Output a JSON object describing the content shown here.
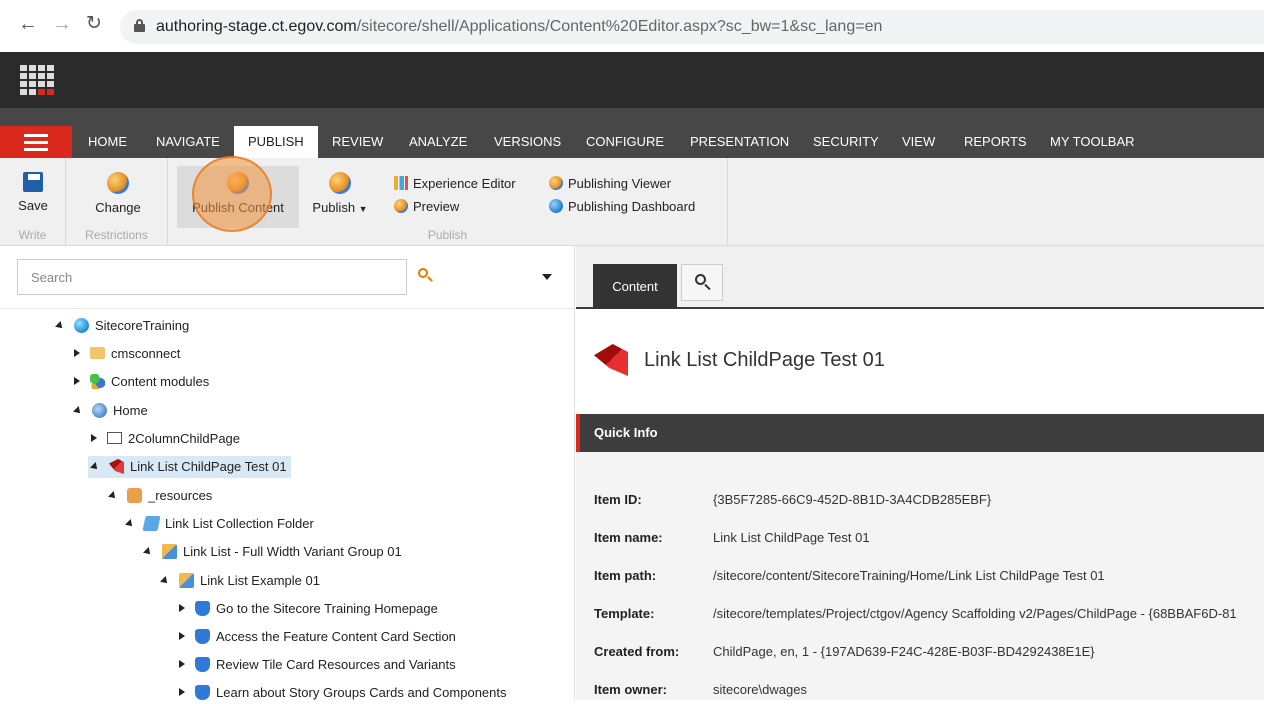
{
  "browser": {
    "back_icon": "back-arrow-icon",
    "forward_icon": "forward-arrow-icon",
    "reload_icon": "reload-icon",
    "url_host": "authoring-stage.ct.egov.com",
    "url_path": "/sitecore/shell/Applications/Content%20Editor.aspx?sc_bw=1&sc_lang=en"
  },
  "ribbon_tabs": [
    "HOME",
    "NAVIGATE",
    "PUBLISH",
    "REVIEW",
    "ANALYZE",
    "VERSIONS",
    "CONFIGURE",
    "PRESENTATION",
    "SECURITY",
    "VIEW",
    "REPORTS",
    "MY TOOLBAR"
  ],
  "active_tab": "PUBLISH",
  "ribbon": {
    "save": "Save",
    "write_group": "Write",
    "change": "Change",
    "restrictions_group": "Restrictions",
    "publish_content": "Publish Content",
    "publish": "Publish",
    "experience_editor": "Experience Editor",
    "preview": "Preview",
    "publishing_viewer": "Publishing Viewer",
    "publishing_dashboard": "Publishing Dashboard",
    "publish_group": "Publish"
  },
  "search": {
    "placeholder": "Search"
  },
  "tree": [
    {
      "label": "SitecoreTraining"
    },
    {
      "label": "cmsconnect"
    },
    {
      "label": "Content modules"
    },
    {
      "label": "Home"
    },
    {
      "label": "2ColumnChildPage"
    },
    {
      "label": "Link List ChildPage Test 01"
    },
    {
      "label": "_resources"
    },
    {
      "label": "Link List Collection Folder"
    },
    {
      "label": "Link List - Full Width Variant Group 01"
    },
    {
      "label": "Link List Example 01"
    },
    {
      "label": "Go to the Sitecore Training Homepage"
    },
    {
      "label": "Access the Feature Content Card Section"
    },
    {
      "label": "Review Tile Card Resources and Variants"
    },
    {
      "label": "Learn about Story Groups Cards and Components"
    }
  ],
  "content_tab": "Content",
  "item_title": "Link List ChildPage Test 01",
  "quick_info": {
    "title": "Quick Info",
    "rows": [
      {
        "label": "Item ID:",
        "value": "{3B5F7285-66C9-452D-8B1D-3A4CDB285EBF}"
      },
      {
        "label": "Item name:",
        "value": "Link List ChildPage Test 01"
      },
      {
        "label": "Item path:",
        "value": "/sitecore/content/SitecoreTraining/Home/Link List ChildPage Test 01"
      },
      {
        "label": "Template:",
        "value": "/sitecore/templates/Project/ctgov/Agency Scaffolding v2/Pages/ChildPage - {68BBAF6D-81"
      },
      {
        "label": "Created from:",
        "value": "ChildPage, en, 1 - {197AD639-F24C-428E-B03F-BD4292438E1E}"
      },
      {
        "label": "Item owner:",
        "value": "sitecore\\dwages"
      }
    ]
  },
  "colors": {
    "accent_red": "#dc291e",
    "dark_bar": "#2b2b2b",
    "tab_bar": "#474747",
    "selection": "#d8e9f6"
  }
}
